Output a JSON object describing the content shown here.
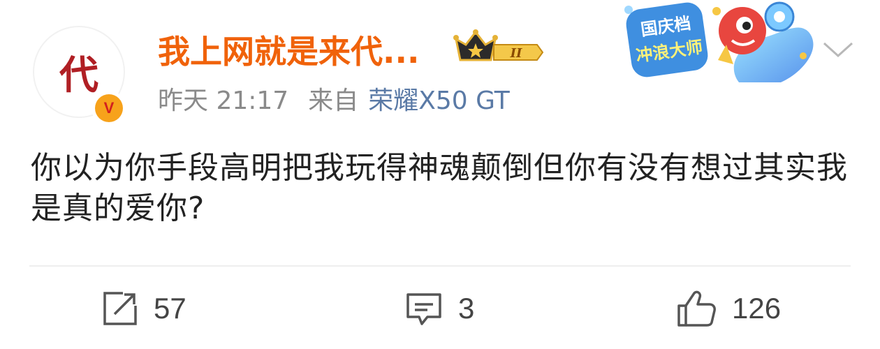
{
  "post": {
    "author": {
      "avatar_text": "代",
      "name": "我上网就是来代...",
      "verified_badge_text": "V",
      "level_badge_text": "II"
    },
    "meta": {
      "time": "昨天 21:17",
      "from_label": "来自",
      "device": "荣耀X50 GT"
    },
    "sticker": {
      "line1": "国庆档",
      "line2": "冲浪大师"
    },
    "content": "你以为你手段高明把我玩得神魂颠倒但你有没有想过其实我是真的爱你?"
  },
  "actions": {
    "repost_count": "57",
    "comment_count": "3",
    "like_count": "126"
  },
  "colors": {
    "username": "#f0620a",
    "device_link": "#5a7aa6",
    "verified_gold": "#f7a21b",
    "avatar_red": "#b01f24"
  }
}
